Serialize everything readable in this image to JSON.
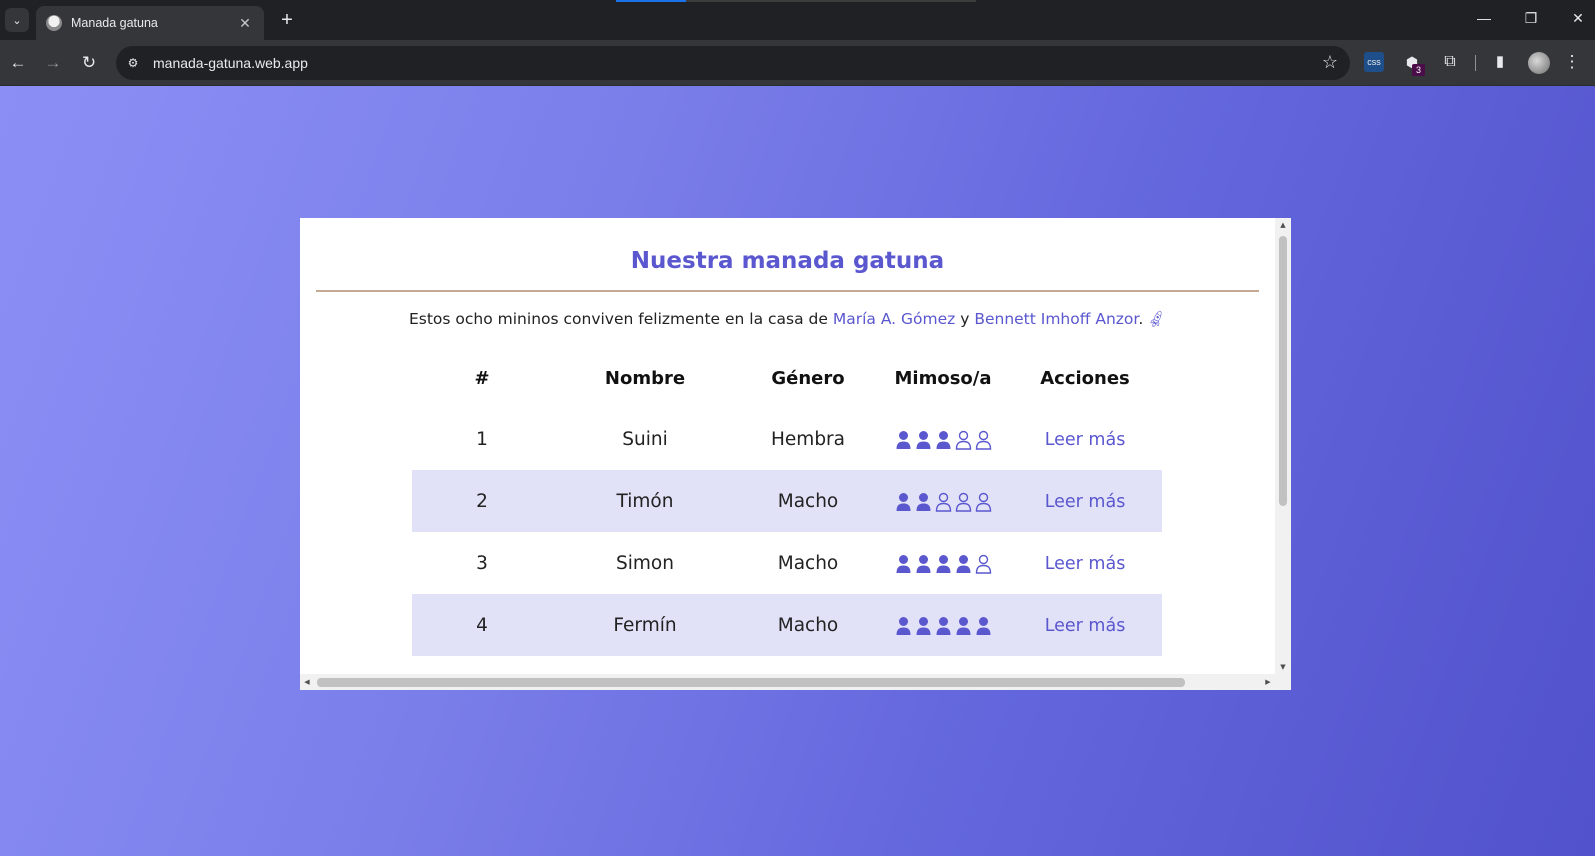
{
  "browser": {
    "tab_title": "Manada gatuna",
    "url": "manada-gatuna.web.app",
    "extension_badge": "3"
  },
  "page": {
    "title": "Nuestra manada gatuna",
    "intro_prefix": "Estos ocho mininos conviven felizmente en la casa de ",
    "owner1": "María A. Gómez",
    "intro_and": " y ",
    "owner2": "Bennett Imhoff Anzor",
    "intro_suffix": ".",
    "table": {
      "headers": [
        "#",
        "Nombre",
        "Género",
        "Mimoso/a",
        "Acciones"
      ],
      "rows": [
        {
          "num": "1",
          "name": "Suini",
          "gender": "Hembra",
          "cuddly": 3,
          "action": "Leer más"
        },
        {
          "num": "2",
          "name": "Timón",
          "gender": "Macho",
          "cuddly": 2,
          "action": "Leer más"
        },
        {
          "num": "3",
          "name": "Simon",
          "gender": "Macho",
          "cuddly": 4,
          "action": "Leer más"
        },
        {
          "num": "4",
          "name": "Fermín",
          "gender": "Macho",
          "cuddly": 5,
          "action": "Leer más"
        }
      ],
      "cuddly_max": 5
    }
  },
  "colors": {
    "accent": "#5a57cf",
    "row_shade": "#e1e1f7",
    "rule": "#c2aa93"
  }
}
